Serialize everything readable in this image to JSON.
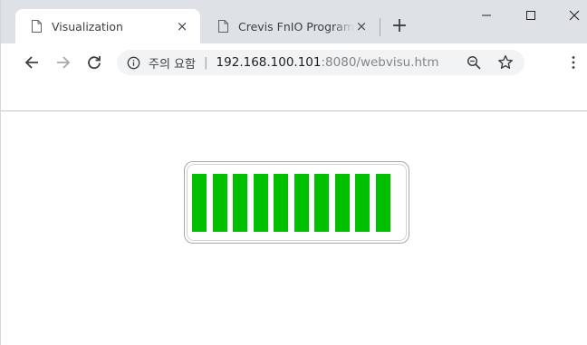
{
  "tabs": [
    {
      "title": "Visualization",
      "active": true,
      "close": "×"
    },
    {
      "title": "Crevis FnIO Programming",
      "active": false,
      "close": "×"
    }
  ],
  "new_tab": "+",
  "address_bar": {
    "security_label": "주의 요함",
    "separator": "|",
    "url_host": "192.168.100.101",
    "url_rest": ":8080/webvisu.htm"
  },
  "icons": {
    "page": "page-icon",
    "back": "arrow-left-icon",
    "forward": "arrow-right-icon",
    "reload": "reload-icon",
    "info": "info-icon",
    "zoom": "zoom-out-icon",
    "bookmark": "star-icon",
    "menu": "three-dots-icon"
  },
  "visualization": {
    "bar_count": 10,
    "filled_count": 10,
    "fill_fraction": 1.0,
    "bar_color": "#00c000"
  }
}
